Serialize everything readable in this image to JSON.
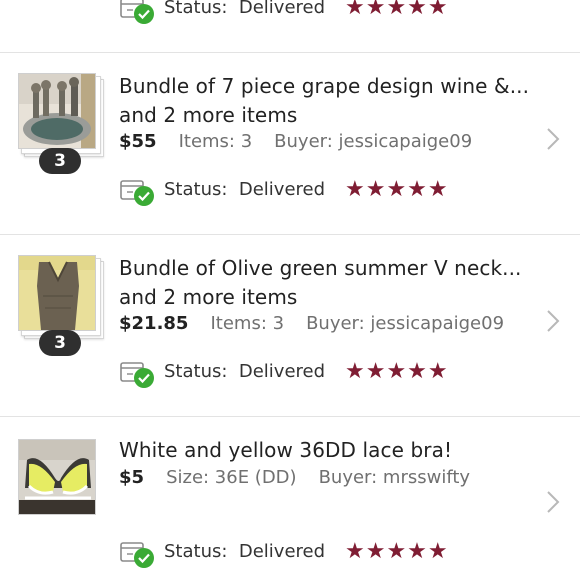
{
  "colors": {
    "star": "#7f1d33",
    "check": "#3aaa35",
    "badge": "#2f2f2f"
  },
  "orders": [
    {
      "status_label": "Status:",
      "status_value": "Delivered",
      "stars": "★★★★★",
      "rating": 5
    },
    {
      "title_line1": "Bundle of 7 piece grape design wine &...",
      "title_line2": "and 2 more items",
      "price": "$55",
      "items": "Items: 3",
      "buyer": "Buyer: jessicapaige09",
      "badge": "3",
      "status_label": "Status:",
      "status_value": "Delivered",
      "stars": "★★★★★",
      "rating": 5
    },
    {
      "title_line1": "Bundle of Olive green summer V neck...",
      "title_line2": "and 2 more items",
      "price": "$21.85",
      "items": "Items: 3",
      "buyer": "Buyer: jessicapaige09",
      "badge": "3",
      "status_label": "Status:",
      "status_value": "Delivered",
      "stars": "★★★★★",
      "rating": 5
    },
    {
      "title_line1": "White and yellow 36DD lace bra!",
      "price": "$5",
      "size": "Size: 36E (DD)",
      "buyer": "Buyer: mrsswifty",
      "status_label": "Status:",
      "status_value": "Delivered",
      "stars": "★★★★★",
      "rating": 5
    }
  ],
  "icons": {
    "status": "package-check-icon",
    "chevron": "chevron-right-icon"
  }
}
